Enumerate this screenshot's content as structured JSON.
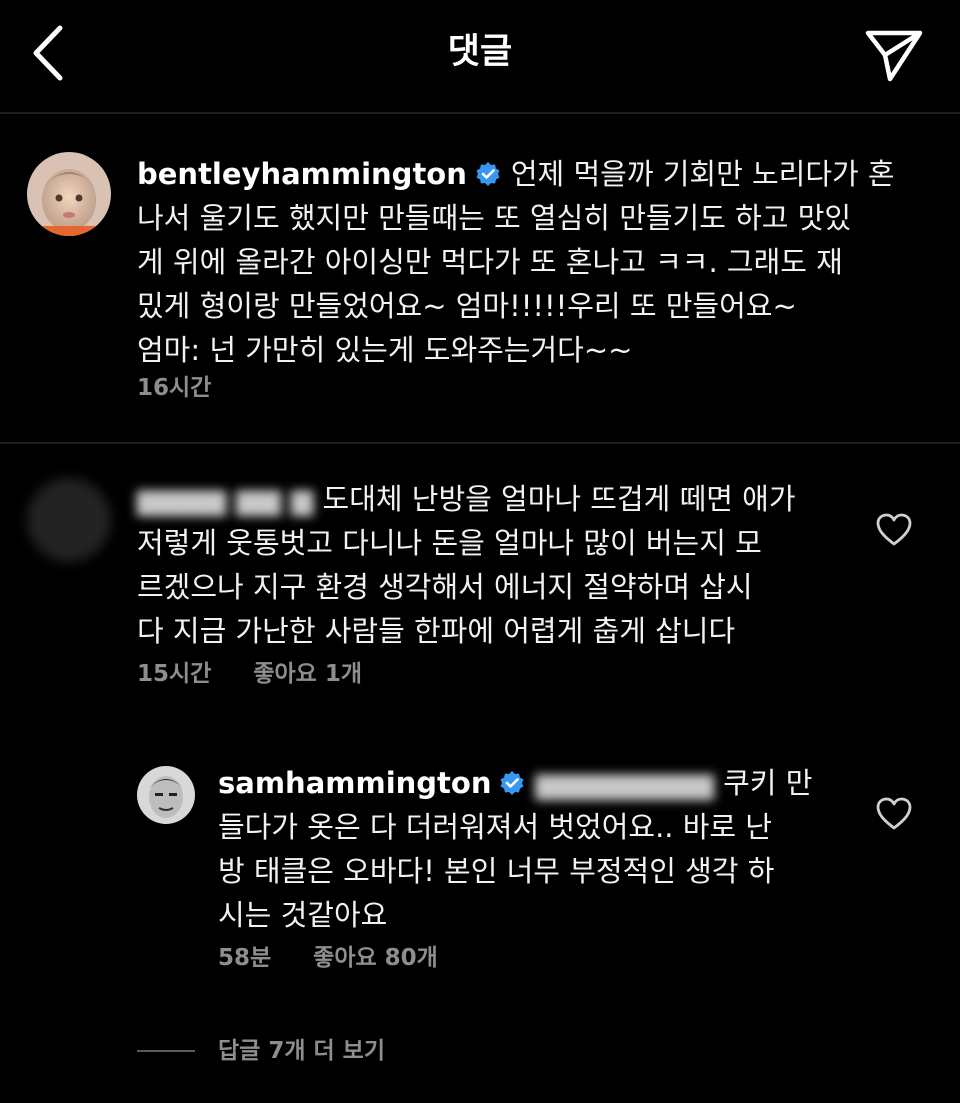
{
  "header": {
    "title": "댓글"
  },
  "comments": [
    {
      "username": "bentleyhammington",
      "verified": true,
      "lines": [
        "언제 먹을까 기회만 노리다가 혼",
        "나서 울기도 했지만 만들때는 또 열심히 만들기도 하고 맛있",
        "게 위에 올라간 아이싱만 먹다가 또 혼나고 ㅋㅋ.  그래도 재",
        "밌게 형이랑 만들었어요~ 엄마!!!!!우리 또 만들어요~",
        "엄마: 넌 가만히 있는게 도와주는거다~~"
      ],
      "time": "16시간"
    },
    {
      "username": "",
      "lines": [
        "도대체 난방을 얼마나  뜨겁게  떼면 애가",
        "저렇게 웃통벗고 다니나  돈을 얼마나 많이 버는지 모",
        "르겠으나  지구 환경 생각해서 에너지 절약하며 삽시",
        "다  지금 가난한 사람들 한파에 어렵게  춥게 삽니다"
      ],
      "time": "15시간",
      "likes": "좋아요 1개"
    }
  ],
  "reply": {
    "username": "samhammington",
    "verified": true,
    "lines": [
      "쿠키 만",
      "들다가 옷은 다 더러워져서 벗었어요.. 바로 난",
      "방 태클은 오바다! 본인 너무 부정적인 생각 하",
      "시는 것같아요"
    ],
    "time": "58분",
    "likes": "좋아요 80개"
  },
  "more_replies": "답글 7개 더 보기",
  "colors": {
    "background": "#000000",
    "verified_blue": "#3897f0",
    "meta_gray": "#8e8e8e"
  },
  "icons": [
    "back-arrow-icon",
    "direct-send-icon",
    "verified-badge-icon",
    "heart-icon"
  ]
}
